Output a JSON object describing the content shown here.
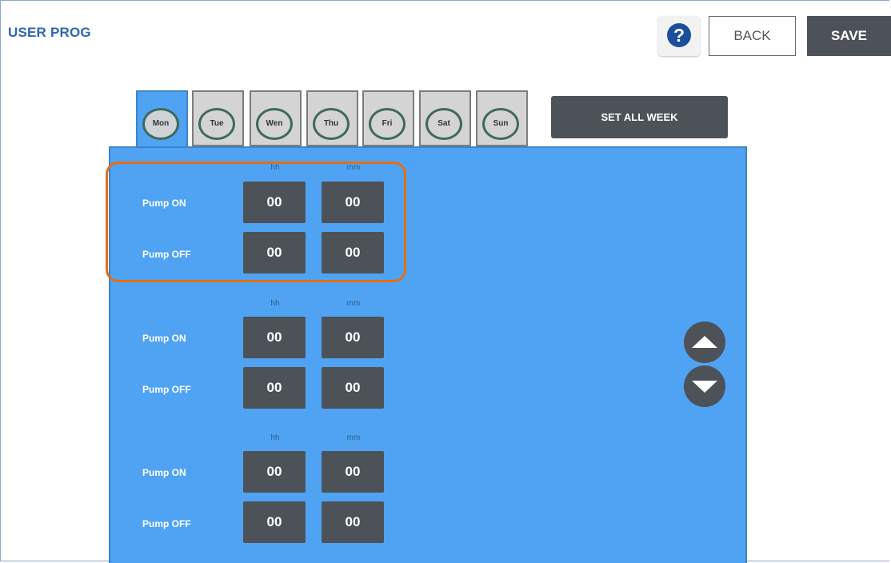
{
  "app": {
    "title": "USER PROG"
  },
  "header": {
    "help_label": "?",
    "back_label": "BACK",
    "save_label": "SAVE"
  },
  "days": [
    "Mon",
    "Tue",
    "Wen",
    "Thu",
    "Fri",
    "Sat",
    "Sun"
  ],
  "active_day": "Mon",
  "set_all_week_label": "SET ALL WEEK",
  "columns": {
    "hours": "hh",
    "minutes": "mm"
  },
  "programs": [
    {
      "on_label": "Pump ON",
      "off_label": "Pump OFF",
      "on_hh": "00",
      "on_mm": "00",
      "off_hh": "00",
      "off_mm": "00"
    },
    {
      "on_label": "Pump ON",
      "off_label": "Pump OFF",
      "on_hh": "00",
      "on_mm": "00",
      "off_hh": "00",
      "off_mm": "00"
    },
    {
      "on_label": "Pump ON",
      "off_label": "Pump OFF",
      "on_hh": "00",
      "on_mm": "00",
      "off_hh": "00",
      "off_mm": "00"
    }
  ],
  "colors": {
    "accent_blue": "#4fa3f2",
    "dark_button": "#4d5258",
    "highlight": "#e26f17",
    "title": "#2f66b4"
  },
  "icons": {
    "help": "question-circle-icon",
    "scroll_up": "triangle-up-icon",
    "scroll_down": "triangle-down-icon"
  }
}
